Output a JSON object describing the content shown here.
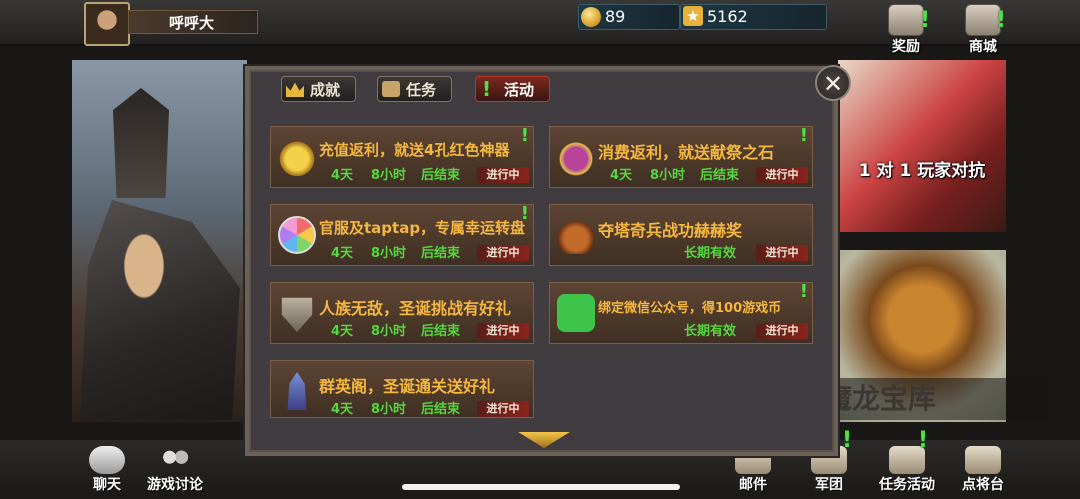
{
  "player": {
    "name": "呼呼大"
  },
  "resources": {
    "gold": "89",
    "stars": "5162"
  },
  "top_buttons": {
    "reward": "奖励",
    "shop": "商城"
  },
  "banners": {
    "pvp": "1 对 1 玩家对抗",
    "dragon": "魔龙宝库"
  },
  "tabs": {
    "achievement": "成就",
    "task": "任务",
    "activity": "活动"
  },
  "activities": [
    {
      "title": "充值返利，就送4孔红色神器",
      "d": "4天",
      "h": "8小时",
      "end": "后结束",
      "status": "进行中",
      "icon": "gold-coins-icon"
    },
    {
      "title": "消费返利，就送献祭之石",
      "d": "4天",
      "h": "8小时",
      "end": "后结束",
      "status": "进行中",
      "icon": "piggy-bank-icon"
    },
    {
      "title": "官服及taptap，专属幸运转盘",
      "d": "4天",
      "h": "8小时",
      "end": "后结束",
      "status": "进行中",
      "icon": "lucky-wheel-icon"
    },
    {
      "title": "夺塔奇兵战功赫赫奖",
      "valid": "长期有效",
      "status": "进行中",
      "icon": "treasure-bag-icon"
    },
    {
      "title": "人族无敌，圣诞挑战有好礼",
      "d": "4天",
      "h": "8小时",
      "end": "后结束",
      "status": "进行中",
      "icon": "shield-icon"
    },
    {
      "title": "绑定微信公众号，得100游戏币",
      "valid": "长期有效",
      "status": "进行中",
      "icon": "wechat-icon"
    },
    {
      "title": "群英阁，圣诞通关送好礼",
      "d": "4天",
      "h": "8小时",
      "end": "后结束",
      "status": "进行中",
      "icon": "tower-icon"
    }
  ],
  "bottom_buttons": {
    "chat": "聊天",
    "forum": "游戏讨论",
    "mail": "邮件",
    "legion": "军团",
    "task_activity": "任务活动",
    "general": "点将台"
  },
  "colors": {
    "title_orange": "#f5b740",
    "time_green": "#56d63f",
    "badge_red": "#8a241c",
    "alert_green": "#4fe04a"
  }
}
